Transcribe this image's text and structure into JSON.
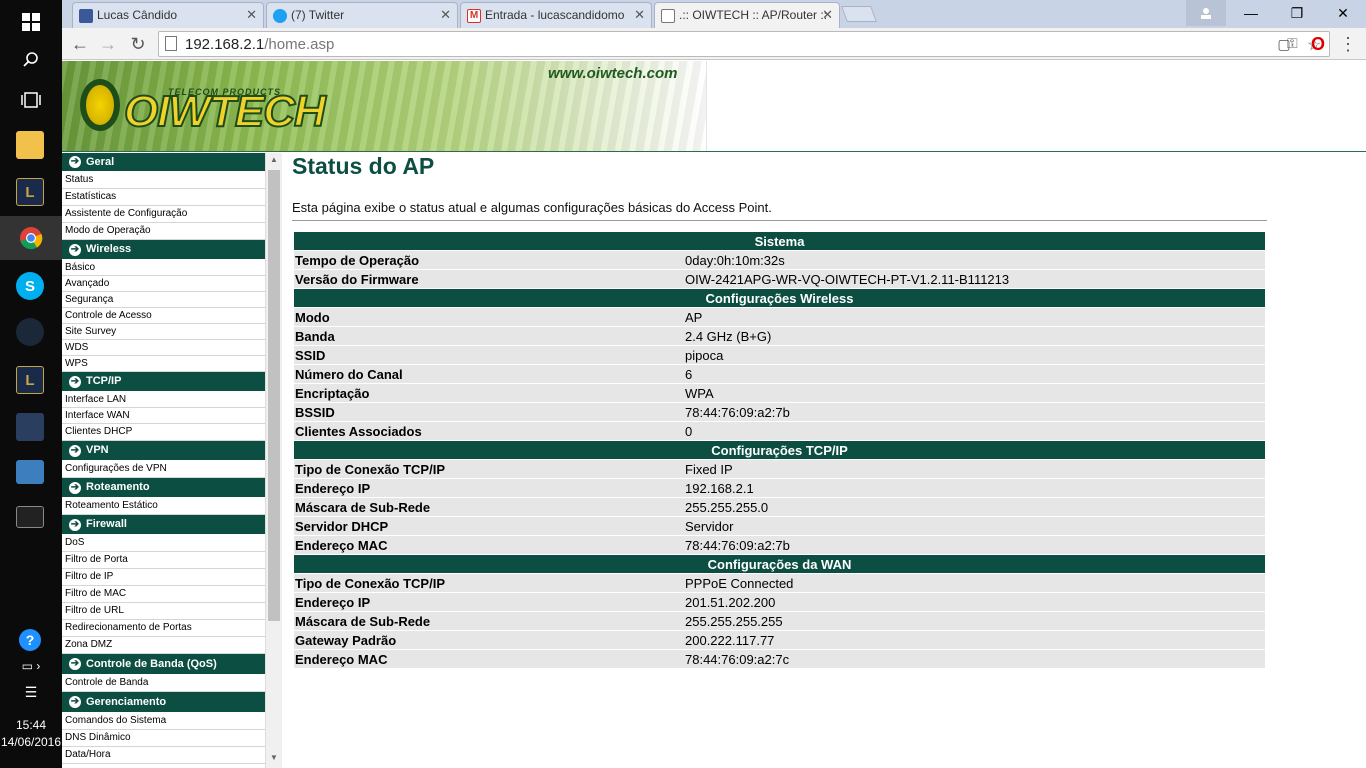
{
  "taskbar": {
    "clock_time": "15:44",
    "clock_date": "14/06/2016",
    "icons": [
      "windows-start-icon",
      "search-icon",
      "task-view-icon",
      "file-explorer-icon",
      "league-of-legends-icon",
      "chrome-icon",
      "skype-icon",
      "steam-icon",
      "league-of-legends-icon-2",
      "app-icon",
      "remote-desktop-icon",
      "terminal-icon",
      "help-icon",
      "network-icon",
      "notifications-icon"
    ]
  },
  "browser": {
    "tabs": [
      {
        "label": "Lucas Cândido",
        "color": "#3b5998"
      },
      {
        "label": "(7) Twitter",
        "color": "#1da1f2"
      },
      {
        "label": "Entrada - lucascandidomo",
        "color": "#d93025"
      },
      {
        "label": ".:: OIWTECH :: AP/Router ::",
        "color": "#777777"
      }
    ],
    "url_host": "192.168.2.1",
    "url_path": "/home.asp"
  },
  "banner": {
    "site_url": "www.oiwtech.com",
    "logo_text": "OIWTECH",
    "logo_sub": "TELECOM PRODUCTS"
  },
  "menu": {
    "sections": [
      {
        "title": "Geral",
        "items": [
          "Status",
          "Estatísticas",
          "Assistente de Configuração",
          "Modo de Operação"
        ]
      },
      {
        "title": "Wireless",
        "items": [
          "Básico",
          "Avançado",
          "Segurança",
          "Controle de Acesso",
          "Site Survey",
          "WDS",
          "WPS"
        ]
      },
      {
        "title": "TCP/IP",
        "items": [
          "Interface LAN",
          "Interface WAN",
          "Clientes DHCP"
        ]
      },
      {
        "title": "VPN",
        "items": [
          "Configurações de VPN"
        ]
      },
      {
        "title": "Roteamento",
        "items": [
          "Roteamento Estático"
        ]
      },
      {
        "title": "Firewall",
        "items": [
          "DoS",
          "Filtro de Porta",
          "Filtro de IP",
          "Filtro de MAC",
          "Filtro de URL",
          "Redirecionamento de Portas",
          "Zona DMZ"
        ]
      },
      {
        "title": "Controle de Banda (QoS)",
        "items": [
          "Controle de Banda"
        ]
      },
      {
        "title": "Gerenciamento",
        "items": [
          "Comandos do Sistema",
          "DNS Dinâmico",
          "Data/Hora"
        ]
      }
    ]
  },
  "main": {
    "title": "Status do AP",
    "description": "Esta página exibe o status atual e algumas configurações básicas do Access Point.",
    "sections": [
      {
        "title": "Sistema",
        "rows": [
          {
            "label": "Tempo de Operação",
            "value": "0day:0h:10m:32s"
          },
          {
            "label": "Versão do Firmware",
            "value": "OIW-2421APG-WR-VQ-OIWTECH-PT-V1.2.11-B111213"
          }
        ]
      },
      {
        "title": "Configurações Wireless",
        "rows": [
          {
            "label": "Modo",
            "value": "AP"
          },
          {
            "label": "Banda",
            "value": "2.4 GHz (B+G)"
          },
          {
            "label": "SSID",
            "value": "pipoca"
          },
          {
            "label": "Número do Canal",
            "value": "6"
          },
          {
            "label": "Encriptação",
            "value": "WPA"
          },
          {
            "label": "BSSID",
            "value": "78:44:76:09:a2:7b"
          },
          {
            "label": "Clientes Associados",
            "value": "0"
          }
        ]
      },
      {
        "title": "Configurações TCP/IP",
        "rows": [
          {
            "label": "Tipo de Conexão TCP/IP",
            "value": "Fixed IP"
          },
          {
            "label": "Endereço IP",
            "value": "192.168.2.1"
          },
          {
            "label": "Máscara de Sub-Rede",
            "value": "255.255.255.0"
          },
          {
            "label": "Servidor DHCP",
            "value": "Servidor"
          },
          {
            "label": "Endereço MAC",
            "value": "78:44:76:09:a2:7b"
          }
        ]
      },
      {
        "title": "Configurações da WAN",
        "rows": [
          {
            "label": "Tipo de Conexão TCP/IP",
            "value": "PPPoE Connected"
          },
          {
            "label": "Endereço IP",
            "value": "201.51.202.200"
          },
          {
            "label": "Máscara de Sub-Rede",
            "value": "255.255.255.255"
          },
          {
            "label": "Gateway Padrão",
            "value": "200.222.117.77"
          },
          {
            "label": "Endereço MAC",
            "value": "78:44:76:09:a2:7c"
          }
        ]
      }
    ]
  }
}
